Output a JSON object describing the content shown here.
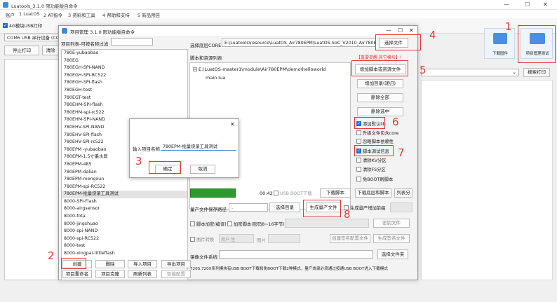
{
  "app": {
    "title": "Luatools_3.1.0 限功能版自命令",
    "menu": [
      "账户",
      "1 LuatOS",
      "2 AT指令",
      "3 资料和工具",
      "4 帮助和支持",
      "5 新品预告"
    ],
    "tab_checkbox_label": "4G模块USB打印",
    "port_label": "COM6 USB 串行设备 (CO",
    "stop_print_label": "停止打印",
    "clear_label": "清除",
    "download_firmware_label": "下载固件",
    "project_mgmt_label": "项目管理测试",
    "search_print_label": "搜索打印"
  },
  "project_window": {
    "title": "项目管理 3.1.0 限功能版自命令",
    "list_header": "项目列表-可按名称过滤",
    "core_label": "选择底层CORE",
    "core_path": "E:\\Luatools\\resource\\LuatOS_Air780EPM\\LuatOS-SoC_V2010_Air780EPM",
    "select_file_label": "选择文件",
    "scripts_label": "脚本和资源列表",
    "warning": "【重要提醒,其它模块】!",
    "tree_root": "E:\\LuatOS-master1\\module\\Air780EPM\\demo\\helloworld",
    "tree_file": "main.lua",
    "add_script_label": "增加脚本或资源文件",
    "add_dir_label": "增加目录(递归)",
    "delete_all_label": "删除全部",
    "delete_selected_label": "删除选中",
    "options": [
      {
        "label": "添加默认lib",
        "checked": true
      },
      {
        "label": "升级文件包含core",
        "checked": false
      },
      {
        "label": "忽略脚本依赖性",
        "checked": false
      },
      {
        "label": "脚本调试信息",
        "checked": true
      },
      {
        "label": "清除KV分区",
        "checked": false
      },
      {
        "label": "清除FS分区",
        "checked": false
      },
      {
        "label": "免BOOT刷脚本",
        "checked": false
      }
    ],
    "progress_time": "00:42",
    "usb_boot_label": "USB BOOT下载",
    "download_script_label": "下载脚本",
    "download_core_script_label": "下载底层和脚本",
    "extra_download_label": "列表分",
    "mass_path_label": "量产文件保存路径",
    "mass_path_value": ".",
    "select_dir_label": "选择目录",
    "gen_mass_label": "生成量产文件",
    "gen_mass_extra_label": "生成量产增加前缀",
    "encrypt_label": "脚本加密(编译)",
    "encrypt_script_label": "加密脚本(密码8~16字节)",
    "password_label": "密钥文件",
    "pic_format_label": "图片转换",
    "pic_format_value": "用户-生",
    "pic_output_label": "图片",
    "bin_label": "创建签名配置文件",
    "bin2_label": "生成签名文件",
    "image_system_label": "镜像文件系统",
    "select_folder_label": "选择文件夹",
    "footer_note": "720S,720X系列模块有USB BOOT下载和免BOOT下载2种模式，量产烧录必须通过按通USB BOOT进入下载模式",
    "items": [
      "780E-yubaobao",
      "780EG",
      "780EGH-SPI-NAND",
      "780EGH-SPI-RC522",
      "780EGH-SPI-flash",
      "780EGH-test",
      "780EGT-test",
      "780EHM-SPI-flash",
      "780EHM-spi-rc522",
      "780EHM-SPI-NAND",
      "780EHV-SPI-NAND",
      "780EHV-SPI-flash",
      "780EHV-SPI-rc522",
      "780EPM -yubaobao",
      "780EPM-1.5寸墨水屏",
      "780EPM-485",
      "780EPM-dalian",
      "780EPM-mengxun",
      "780EPM-spi-RC522",
      "780EPM-批量烧录工具测试",
      "8000-SPI-Flash",
      "8000-airgsensor",
      "8000-fota",
      "8000-jingshuao",
      "8000-spi-NAND",
      "8000-spi-RC522",
      "8000-test",
      "8000-xingpai-littleflash"
    ],
    "bottom_buttons": [
      "创建",
      "删除",
      "导入项目",
      "导出项目",
      "项目重命名",
      "项目克隆",
      "刷新列表",
      "智能配置"
    ]
  },
  "dialog": {
    "label": "输入项目名称:",
    "value": "780EPM-批量烧录工具测试",
    "ok_label": "确定",
    "cancel_label": "取消"
  },
  "annotations": [
    "1",
    "2",
    "3",
    "4",
    "5",
    "6",
    "7",
    "8"
  ],
  "colors": {
    "accent": "#e53935",
    "progress": "#2e9a2e",
    "checkbox": "#1e6fd9"
  }
}
